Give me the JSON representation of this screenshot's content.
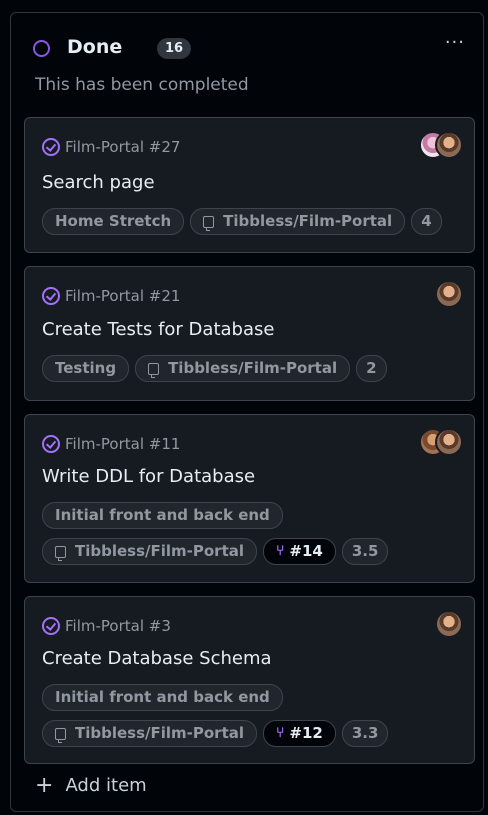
{
  "column": {
    "title": "Done",
    "count": "16",
    "description": "This has been completed",
    "more_label": "···",
    "add_item_label": "Add item",
    "status_color": "#8957e5"
  },
  "cards": [
    {
      "ref": "Film-Portal #27",
      "title": "Search page",
      "labels": [
        "Home Stretch"
      ],
      "repo": "Tibbless/Film-Portal",
      "linked_pr": "",
      "estimate": "4",
      "assignees": [
        "avatar-1",
        "avatar-2"
      ]
    },
    {
      "ref": "Film-Portal #21",
      "title": "Create Tests for Database",
      "labels": [
        "Testing"
      ],
      "repo": "Tibbless/Film-Portal",
      "linked_pr": "",
      "estimate": "2",
      "assignees": [
        "avatar-1"
      ]
    },
    {
      "ref": "Film-Portal #11",
      "title": "Write DDL for Database",
      "labels": [
        "Initial front and back end"
      ],
      "repo": "Tibbless/Film-Portal",
      "linked_pr": "#14",
      "estimate": "3.5",
      "assignees": [
        "avatar-1",
        "avatar-2"
      ]
    },
    {
      "ref": "Film-Portal #3",
      "title": "Create Database Schema",
      "labels": [
        "Initial front and back end"
      ],
      "repo": "Tibbless/Film-Portal",
      "linked_pr": "#12",
      "estimate": "3.3",
      "assignees": [
        "avatar-1"
      ]
    }
  ],
  "icons": {
    "status": "status-ring-icon",
    "done": "check-circle-icon",
    "repo": "repo-icon",
    "pr": "git-merge-icon",
    "add": "plus-icon"
  },
  "colors": {
    "background": "#010409",
    "card": "#161b22",
    "border": "#3d444d",
    "done_purple": "#a371f7",
    "muted_text": "#9198a1"
  }
}
